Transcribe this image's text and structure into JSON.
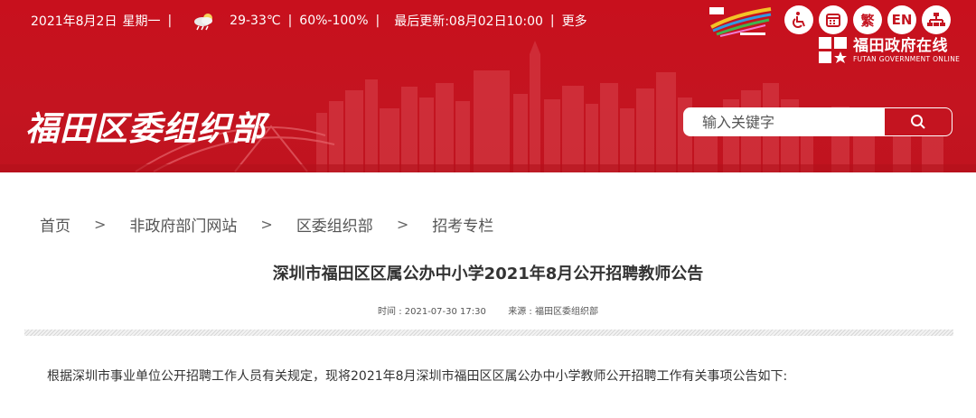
{
  "topbar": {
    "date": "2021年8月2日",
    "weekday": "星期一",
    "temperature": "29-33℃",
    "humidity": "60%-100%",
    "updated": "最后更新:08月02日10:00",
    "more": "更多",
    "weather_icon": "cloud-rain-icon"
  },
  "site_title": "福田区委组织部",
  "search": {
    "placeholder": "输入关键字",
    "icon": "search-icon"
  },
  "tools": {
    "accessibility_icon": "wheelchair-icon",
    "elder_icon": "calendar-grid-icon",
    "traditional_label": "繁",
    "english_label": "EN",
    "sitemap_icon": "sitemap-icon"
  },
  "gov_logo": {
    "cn": "福田政府在线",
    "en": "FUTAN GOVERNMENT ONLINE"
  },
  "breadcrumb": [
    {
      "label": "首页"
    },
    {
      "label": "非政府部门网站"
    },
    {
      "label": "区委组织部"
    },
    {
      "label": "招考专栏"
    }
  ],
  "breadcrumb_sep": ">",
  "article": {
    "title": "深圳市福田区区属公办中小学2021年8月公开招聘教师公告",
    "time": "时间 : 2021-07-30 17:30",
    "source": "来源 : 福田区委组织部",
    "intro": "根据深圳市事业单位公开招聘工作人员有关规定，现将2021年8月深圳市福田区区属公办中小学教师公开招聘工作有关事项公告如下:"
  },
  "colors": {
    "brand_red": "#c41420",
    "text": "#333333"
  }
}
